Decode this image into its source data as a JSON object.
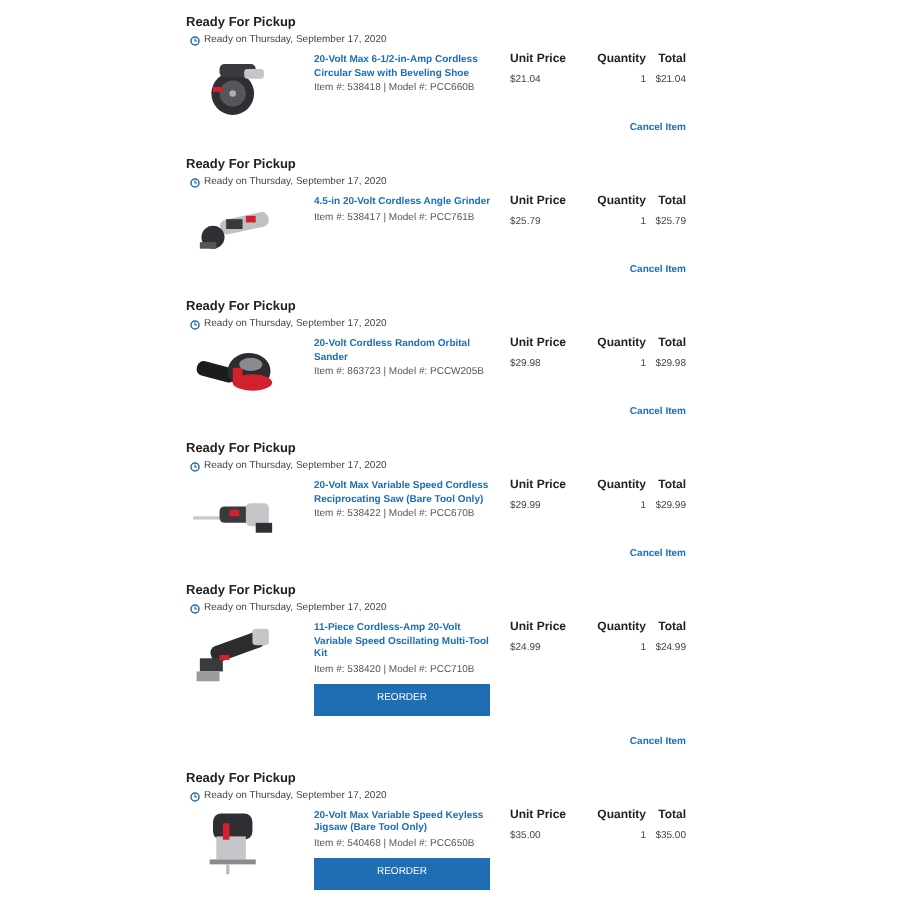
{
  "orders": [
    {
      "heading": "Ready For Pickup",
      "ready": "Ready on Thursday, September 17, 2020",
      "product": {
        "name": "20-Volt Max 6-1/2-in-Amp Cordless Circular Saw with Beveling Shoe",
        "numbers": "Item #: 538418 | Model #: PCC660B"
      },
      "columns": [
        "Unit Price",
        "Quantity",
        "Total"
      ],
      "unit_price": "$21.04",
      "quantity": "1",
      "total": "$21.04",
      "cancel": "Cancel Item"
    },
    {
      "heading": "Ready For Pickup",
      "ready": "Ready on Thursday, September 17, 2020",
      "product": {
        "name": "4.5-in 20-Volt Cordless Angle Grinder",
        "numbers": "Item #: 538417 | Model #: PCC761B"
      },
      "columns": [
        "Unit Price",
        "Quantity",
        "Total"
      ],
      "unit_price": "$25.79",
      "quantity": "1",
      "total": "$25.79",
      "cancel": "Cancel Item"
    },
    {
      "heading": "Ready For Pickup",
      "ready": "Ready on Thursday, September 17, 2020",
      "product": {
        "name": "20-Volt Cordless Random Orbital Sander",
        "numbers": "Item #: 863723 | Model #: PCCW205B"
      },
      "columns": [
        "Unit Price",
        "Quantity",
        "Total"
      ],
      "unit_price": "$29.98",
      "quantity": "1",
      "total": "$29.98",
      "cancel": "Cancel Item"
    },
    {
      "heading": "Ready For Pickup",
      "ready": "Ready on Thursday, September 17, 2020",
      "product": {
        "name": "20-Volt Max Variable Speed Cordless Reciprocating Saw (Bare Tool Only)",
        "numbers": "Item #: 538422 | Model #: PCC670B"
      },
      "columns": [
        "Unit Price",
        "Quantity",
        "Total"
      ],
      "unit_price": "$29.99",
      "quantity": "1",
      "total": "$29.99",
      "cancel": "Cancel Item"
    },
    {
      "heading": "Ready For Pickup",
      "ready": "Ready on Thursday, September 17, 2020",
      "product": {
        "name": "11-Piece Cordless-Amp 20-Volt Variable Speed Oscillating Multi-Tool Kit",
        "numbers": "Item #: 538420 | Model #: PCC710B"
      },
      "columns": [
        "Unit Price",
        "Quantity",
        "Total"
      ],
      "unit_price": "$24.99",
      "quantity": "1",
      "total": "$24.99",
      "reorder": "REORDER",
      "cancel": "Cancel Item"
    },
    {
      "heading": "Ready For Pickup",
      "ready": "Ready on Thursday, September 17, 2020",
      "product": {
        "name": "20-Volt Max Variable Speed Keyless Jigsaw (Bare Tool Only)",
        "numbers": "Item #: 540468 | Model #: PCC650B"
      },
      "columns": [
        "Unit Price",
        "Quantity",
        "Total"
      ],
      "unit_price": "$35.00",
      "quantity": "1",
      "total": "$35.00",
      "reorder": "REORDER"
    }
  ]
}
